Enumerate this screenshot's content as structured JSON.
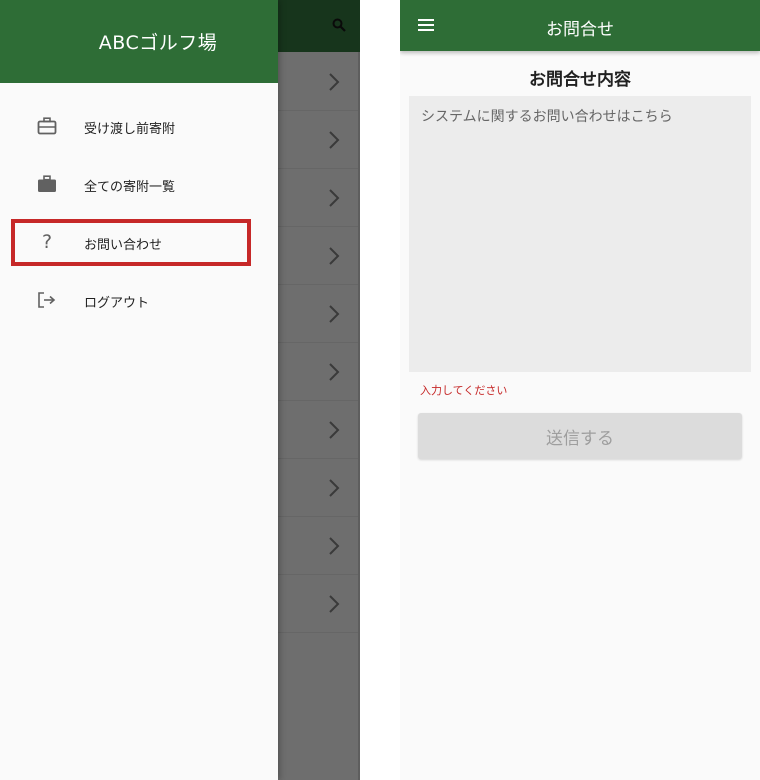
{
  "drawer": {
    "title": "ABCゴルフ場",
    "items": [
      {
        "icon": "briefcase-outline-icon",
        "label": "受け渡し前寄附"
      },
      {
        "icon": "briefcase-filled-icon",
        "label": "全ての寄附一覧"
      },
      {
        "icon": "question-mark-icon",
        "label": "お問い合わせ",
        "highlighted": true
      },
      {
        "icon": "logout-icon",
        "label": "ログアウト"
      }
    ],
    "header_color": "#2e6d36",
    "highlight_color": "#c62828"
  },
  "background_list": {
    "search_icon": "search-icon",
    "chevron_icon": "chevron-right-icon",
    "row_count": 10
  },
  "inquiry": {
    "appbar_title": "お問合せ",
    "menu_icon": "hamburger-menu-icon",
    "section_title": "お問合せ内容",
    "textarea_placeholder": "システムに関するお問い合わせはこちら",
    "textarea_value": "",
    "error_message": "入力してください",
    "submit_label": "送信する",
    "error_color": "#c62828"
  }
}
